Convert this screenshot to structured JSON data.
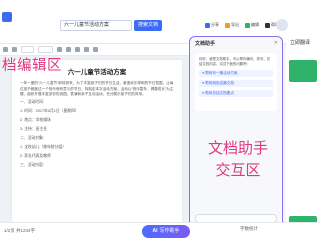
{
  "header": {
    "search_value": "六一儿童节活动方案",
    "search_button": "搜索文档",
    "tools": [
      "分享",
      "导出",
      "编辑",
      "帮助"
    ]
  },
  "document": {
    "title": "六一儿童节活动方案",
    "intro": "一年一度的“六一儿童节”即将到来，为了丰富孩子们的节日生活，营造欢乐祥和的节日氛围，让每位孩子都度过一个快乐而有意义的节日，特制定本次活动方案。活动以“快乐童年，健康成长”为主题，组织开展丰富多彩的游园、表演和亲子互动活动，充分展示孩子们的风采。",
    "items": [
      "一、活动时间：",
      "1. 时间：2017年6月1日（星期四）",
      "2. 地点：学校操场",
      "3. 主持：班主任",
      "二、活动对象：",
      "1. 全校幼儿（按年龄分组）",
      "2. 家长代表及教师",
      "三、活动内容："
    ]
  },
  "overlays": {
    "left_label": "档编辑区",
    "right_label": "文档助手交互区"
  },
  "assistant": {
    "title": "文档助手",
    "greeting": "你好，我是文档助手，可以帮你编写、改写、总结文档内容，试试下面的问题吧：",
    "suggestions": [
      "● 帮我写一篇活动方案",
      "● 帮我润色这篇文档",
      "● 帮我总结文档要点"
    ]
  },
  "side_panel": {
    "title": "立即翻译"
  },
  "footer": {
    "status": "1/2页  共1234字",
    "ai_label": "AI",
    "ai_button": "写作助手",
    "word_count_label": "字数统计"
  },
  "colors": {
    "accent": "#3b6cf6",
    "annotation": "#e0387f",
    "assistant_border": "#8b6df0",
    "green": "#2fb36b"
  }
}
